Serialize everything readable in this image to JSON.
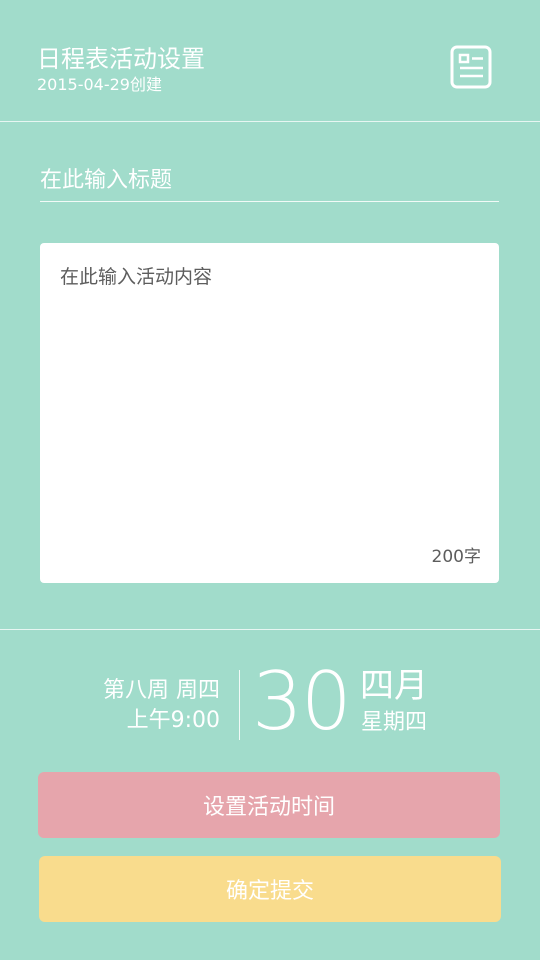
{
  "header": {
    "title": "日程表活动设置",
    "subtitle": "2015-04-29创建",
    "icon": "document-list-icon"
  },
  "form": {
    "title_placeholder": "在此输入标题",
    "title_value": "",
    "content_placeholder": "在此输入活动内容",
    "content_value": "",
    "char_limit": "200字"
  },
  "date": {
    "week_label": "第八周 周四",
    "time": "上午9:00",
    "day": "30",
    "month": "四月",
    "weekday": "星期四"
  },
  "buttons": {
    "set_time": "设置活动时间",
    "submit": "确定提交"
  },
  "colors": {
    "background": "#a1dccb",
    "set_time_button": "#e6a5ac",
    "submit_button": "#f9dc8d",
    "text_light": "#ffffff",
    "text_dark": "#5d5d5d"
  }
}
